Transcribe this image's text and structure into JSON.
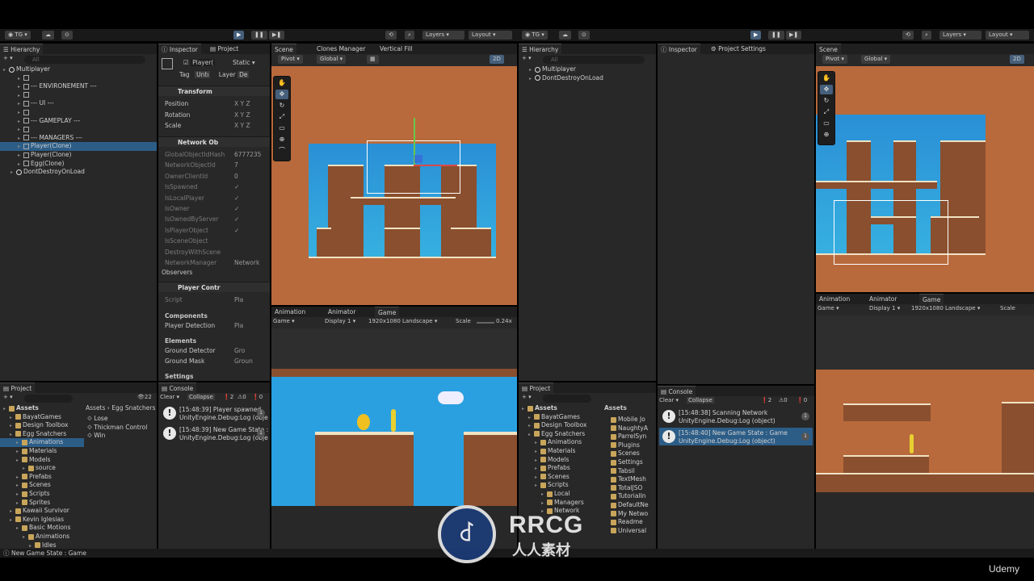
{
  "left_editor": {
    "topbar": {
      "account": "TG",
      "layers": "Layers",
      "layout": "Layout"
    },
    "hierarchy": {
      "tab": "Hierarchy",
      "search_placeholder": "All",
      "items": [
        {
          "label": "Multiplayer",
          "indent": 0,
          "icon": "unity"
        },
        {
          "label": "",
          "indent": 2,
          "icon": "cube"
        },
        {
          "label": "--- ENVIRONEMENT ---",
          "indent": 2,
          "icon": "cube"
        },
        {
          "label": "",
          "indent": 2,
          "icon": "cube"
        },
        {
          "label": "--- UI ---",
          "indent": 2,
          "icon": "cube"
        },
        {
          "label": "",
          "indent": 2,
          "icon": "cube"
        },
        {
          "label": "--- GAMEPLAY ---",
          "indent": 2,
          "icon": "cube"
        },
        {
          "label": "",
          "indent": 2,
          "icon": "cube"
        },
        {
          "label": "--- MANAGERS ---",
          "indent": 2,
          "icon": "cube"
        },
        {
          "label": "Player(Clone)",
          "indent": 2,
          "icon": "cube",
          "selected": true
        },
        {
          "label": "Player(Clone)",
          "indent": 2,
          "icon": "cube"
        },
        {
          "label": "Egg(Clone)",
          "indent": 2,
          "icon": "cube"
        },
        {
          "label": "DontDestroyOnLoad",
          "indent": 1,
          "icon": "unity"
        }
      ]
    },
    "inspector": {
      "tabs": [
        "Inspector",
        "Project"
      ],
      "object_name": "Player(",
      "static_label": "Static",
      "tag_label": "Tag",
      "tag_value": "Untı",
      "layer_label": "Layer",
      "layer_value": "De",
      "transform": {
        "title": "Transform",
        "rows": [
          {
            "label": "Position",
            "axes": "X  Y  Z"
          },
          {
            "label": "Rotation",
            "axes": "X  Y  Z"
          },
          {
            "label": "Scale",
            "axes": "X  Y  Z"
          }
        ]
      },
      "network_object": {
        "title": "Network Ob",
        "rows": [
          {
            "label": "GlobalObjectIdHash",
            "value": "6777235"
          },
          {
            "label": "NetworkObjectId",
            "value": "7"
          },
          {
            "label": "OwnerClientId",
            "value": "0"
          },
          {
            "label": "IsSpawned",
            "value": "✓"
          },
          {
            "label": "IsLocalPlayer",
            "value": "✓"
          },
          {
            "label": "IsOwner",
            "value": "✓"
          },
          {
            "label": "IsOwnedByServer",
            "value": "✓"
          },
          {
            "label": "IsPlayerObject",
            "value": "✓"
          },
          {
            "label": "IsSceneObject",
            "value": ""
          },
          {
            "label": "DestroyWithScene",
            "value": ""
          },
          {
            "label": "NetworkManager",
            "value": "Network"
          }
        ],
        "observers": "Observers"
      },
      "player_controller": {
        "title": "Player Contr",
        "script_label": "Script",
        "script_value": "Pla",
        "components_header": "Components",
        "player_detection_label": "Player Detection",
        "player_detection_value": "Pla",
        "elements_header": "Elements",
        "ground_detector_label": "Ground Detector",
        "ground_detector_value": "Gro",
        "ground_mask_label": "Ground Mask",
        "ground_mask_value": "Groun",
        "settings_header": "Settings"
      }
    },
    "scene": {
      "tabs": [
        "Scene",
        "Clones Manager",
        "Vertical Fill"
      ],
      "pivot": "Pivot",
      "global": "Global",
      "mode_2d": "2D"
    },
    "game": {
      "tabs": [
        "Animation",
        "Animator",
        "Game"
      ],
      "game_dropdown": "Game",
      "display": "Display 1",
      "resolution": "1920x1080 Landscape",
      "scale_label": "Scale",
      "scale_value": "0.24x"
    },
    "project": {
      "tab": "Project",
      "hidden_count": "22",
      "breadcrumb": [
        "Assets",
        "Egg Snatchers"
      ],
      "tree": [
        {
          "label": "Assets",
          "indent": 0,
          "bold": true
        },
        {
          "label": "BayatGames",
          "indent": 1
        },
        {
          "label": "Design Toolbox",
          "indent": 1
        },
        {
          "label": "Egg Snatchers",
          "indent": 1
        },
        {
          "label": "Animations",
          "indent": 2,
          "selected": true
        },
        {
          "label": "Materials",
          "indent": 2
        },
        {
          "label": "Models",
          "indent": 2
        },
        {
          "label": "source",
          "indent": 3
        },
        {
          "label": "Prefabs",
          "indent": 2
        },
        {
          "label": "Scenes",
          "indent": 2
        },
        {
          "label": "Scripts",
          "indent": 2
        },
        {
          "label": "Sprites",
          "indent": 2
        },
        {
          "label": "Kawaii Survivor",
          "indent": 1
        },
        {
          "label": "Kevin Iglesias",
          "indent": 1
        },
        {
          "label": "Basic Motions",
          "indent": 2
        },
        {
          "label": "Animations",
          "indent": 3
        },
        {
          "label": "Idles",
          "indent": 4
        }
      ],
      "files": [
        "Lose",
        "Thickman Control",
        "Win"
      ]
    },
    "console": {
      "tab": "Console",
      "clear": "Clear",
      "collapse": "Collapse",
      "count_warn": "2",
      "count_err": "0",
      "count_info": "0",
      "entries": [
        {
          "line1": "[15:48:39] Player spawned",
          "line2": "UnityEngine.Debug:Log (object",
          "count": "1"
        },
        {
          "line1": "[15:48:39] New Game State : G",
          "line2": "UnityEngine.Debug:Log (objec",
          "count": "1"
        }
      ]
    },
    "status": "New Game State : Game"
  },
  "right_editor": {
    "topbar": {
      "account": "TG",
      "layers": "Layers",
      "layout": "Layout"
    },
    "hierarchy": {
      "tab": "Hierarchy",
      "search_placeholder": "All",
      "items": [
        {
          "label": "Multiplayer",
          "indent": 1,
          "icon": "unity"
        },
        {
          "label": "DontDestroyOnLoad",
          "indent": 1,
          "icon": "unity"
        }
      ]
    },
    "inspector": {
      "tabs": [
        "Inspector",
        "Project Settings"
      ]
    },
    "scene": {
      "tab": "Scene",
      "pivot": "Pivot",
      "global": "Global",
      "mode_2d": "2D"
    },
    "game": {
      "tabs": [
        "Animation",
        "Animator",
        "Game"
      ],
      "game_dropdown": "Game",
      "display": "Display 1",
      "resolution": "1920x1080 Landscape",
      "scale_label": "Scale"
    },
    "project": {
      "tab": "Project",
      "tree": [
        {
          "label": "Assets",
          "indent": 0,
          "bold": true
        },
        {
          "label": "BayatGames",
          "indent": 1
        },
        {
          "label": "Design Toolbox",
          "indent": 1
        },
        {
          "label": "Egg Snatchers",
          "indent": 1
        },
        {
          "label": "Animations",
          "indent": 2
        },
        {
          "label": "Materials",
          "indent": 2
        },
        {
          "label": "Models",
          "indent": 2
        },
        {
          "label": "Prefabs",
          "indent": 2
        },
        {
          "label": "Scenes",
          "indent": 2
        },
        {
          "label": "Scripts",
          "indent": 2
        },
        {
          "label": "Local",
          "indent": 3
        },
        {
          "label": "Managers",
          "indent": 3
        },
        {
          "label": "Network",
          "indent": 3
        }
      ],
      "asset_header": "Assets",
      "assets": [
        "Mobile Jo",
        "NaughtyA",
        "ParrelSyn",
        "Plugins",
        "Scenes",
        "Settings",
        "Tabsil",
        "TextMesh",
        "TotalJSO",
        "TutorialIn",
        "DefaultNe",
        "My Netwo",
        "Readme",
        "Universal"
      ]
    },
    "console": {
      "tab": "Console",
      "clear": "Clear",
      "collapse": "Collapse",
      "count_warn": "2",
      "count_err": "0",
      "count_info": "0",
      "entries": [
        {
          "line1": "[15:48:38] Scanning Network",
          "line2": "UnityEngine.Debug:Log (object)",
          "count": "1"
        },
        {
          "line1": "[15:48:40] New Game State : Game",
          "line2": "UnityEngine.Debug:Log (object)",
          "count": "1",
          "selected": true
        }
      ]
    }
  },
  "watermark": {
    "logo": "RRCG",
    "cn": "人人素材"
  },
  "brand": "Udemy",
  "colors": {
    "selection": "#2c5d87",
    "play_accent": "#46607c",
    "ground": "#8a4f2e",
    "sky": "#2a8fd6",
    "scene_bg": "#b86a3c"
  }
}
